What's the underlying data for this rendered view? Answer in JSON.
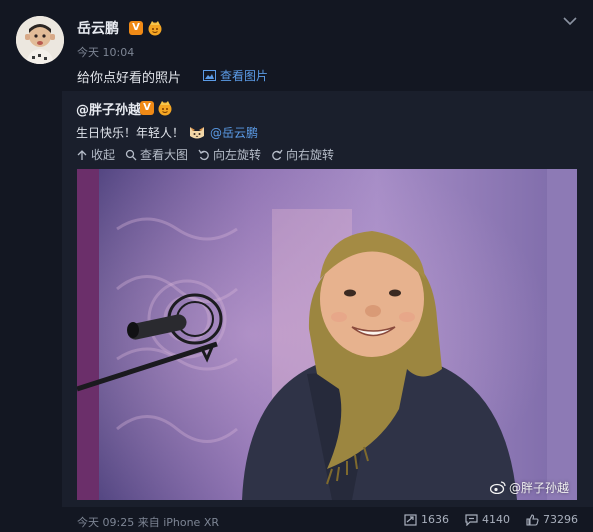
{
  "post": {
    "author": "岳云鹏",
    "time": "今天 10:04",
    "text": "给你点好看的照片",
    "view_pics_label": "查看图片"
  },
  "forward": {
    "author": "@胖子孙越",
    "text": "生日快乐！年轻人！",
    "mention": "@岳云鹏",
    "tools": {
      "collapse": "收起",
      "view_large": "查看大图",
      "rotate_left": "向左旋转",
      "rotate_right": "向右旋转"
    },
    "watermark": "@胖子孙越"
  },
  "footer": {
    "time_source": "今天 09:25 来自 iPhone XR",
    "reposts": "1636",
    "comments": "4140",
    "likes": "73296"
  },
  "colors": {
    "background": "#131722",
    "link": "#5b9be6",
    "verified": "#f08a16"
  },
  "icons": [
    "chevron-down-icon",
    "image-icon",
    "verified-icon",
    "fan-badge-icon",
    "cat-emoji-icon",
    "collapse-icon",
    "search-icon",
    "rotate-left-icon",
    "rotate-right-icon",
    "weibo-logo-icon",
    "repost-icon",
    "comment-icon",
    "like-icon"
  ]
}
